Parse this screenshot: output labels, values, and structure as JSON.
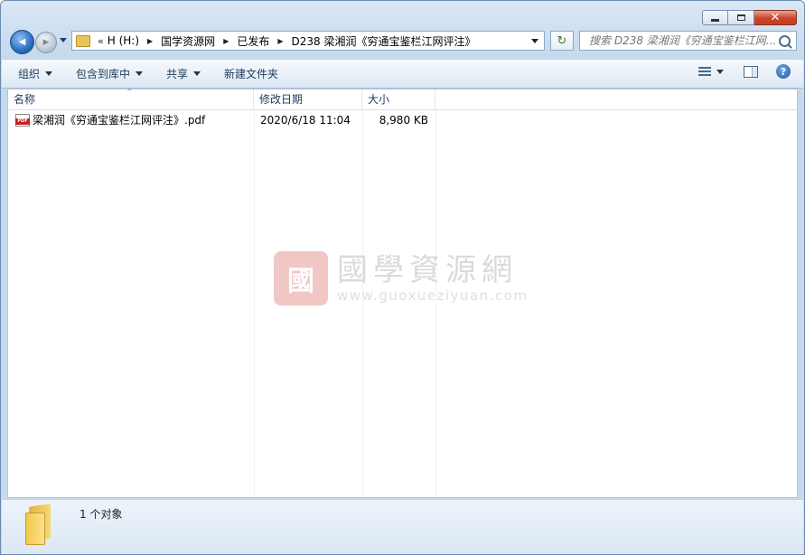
{
  "window": {
    "close_glyph": "✕"
  },
  "nav": {
    "back_icon": "◀",
    "forward_icon": "▶",
    "chevron": "«",
    "breadcrumbs": [
      "H (H:)",
      "国学资源网",
      "已发布",
      "D238 梁湘润《穷通宝鉴栏江网评注》"
    ],
    "separator": "▶",
    "refresh_icon": "↻",
    "search_placeholder": "搜索 D238 梁湘润《穷通宝鉴栏江网..."
  },
  "toolbar": {
    "organize": "组织",
    "include_library": "包含到库中",
    "share": "共享",
    "new_folder": "新建文件夹",
    "help": "?"
  },
  "columns": {
    "name": "名称",
    "date": "修改日期",
    "size": "大小",
    "sort_indicator": "^"
  },
  "files": [
    {
      "name": "梁湘润《穷通宝鉴栏江网评注》.pdf",
      "date": "2020/6/18 11:04",
      "size": "8,980 KB"
    }
  ],
  "watermark": {
    "seal": "國",
    "title": "國學資源網",
    "url": "www.guoxueziyuan.com"
  },
  "status": {
    "text": "1 个对象"
  }
}
